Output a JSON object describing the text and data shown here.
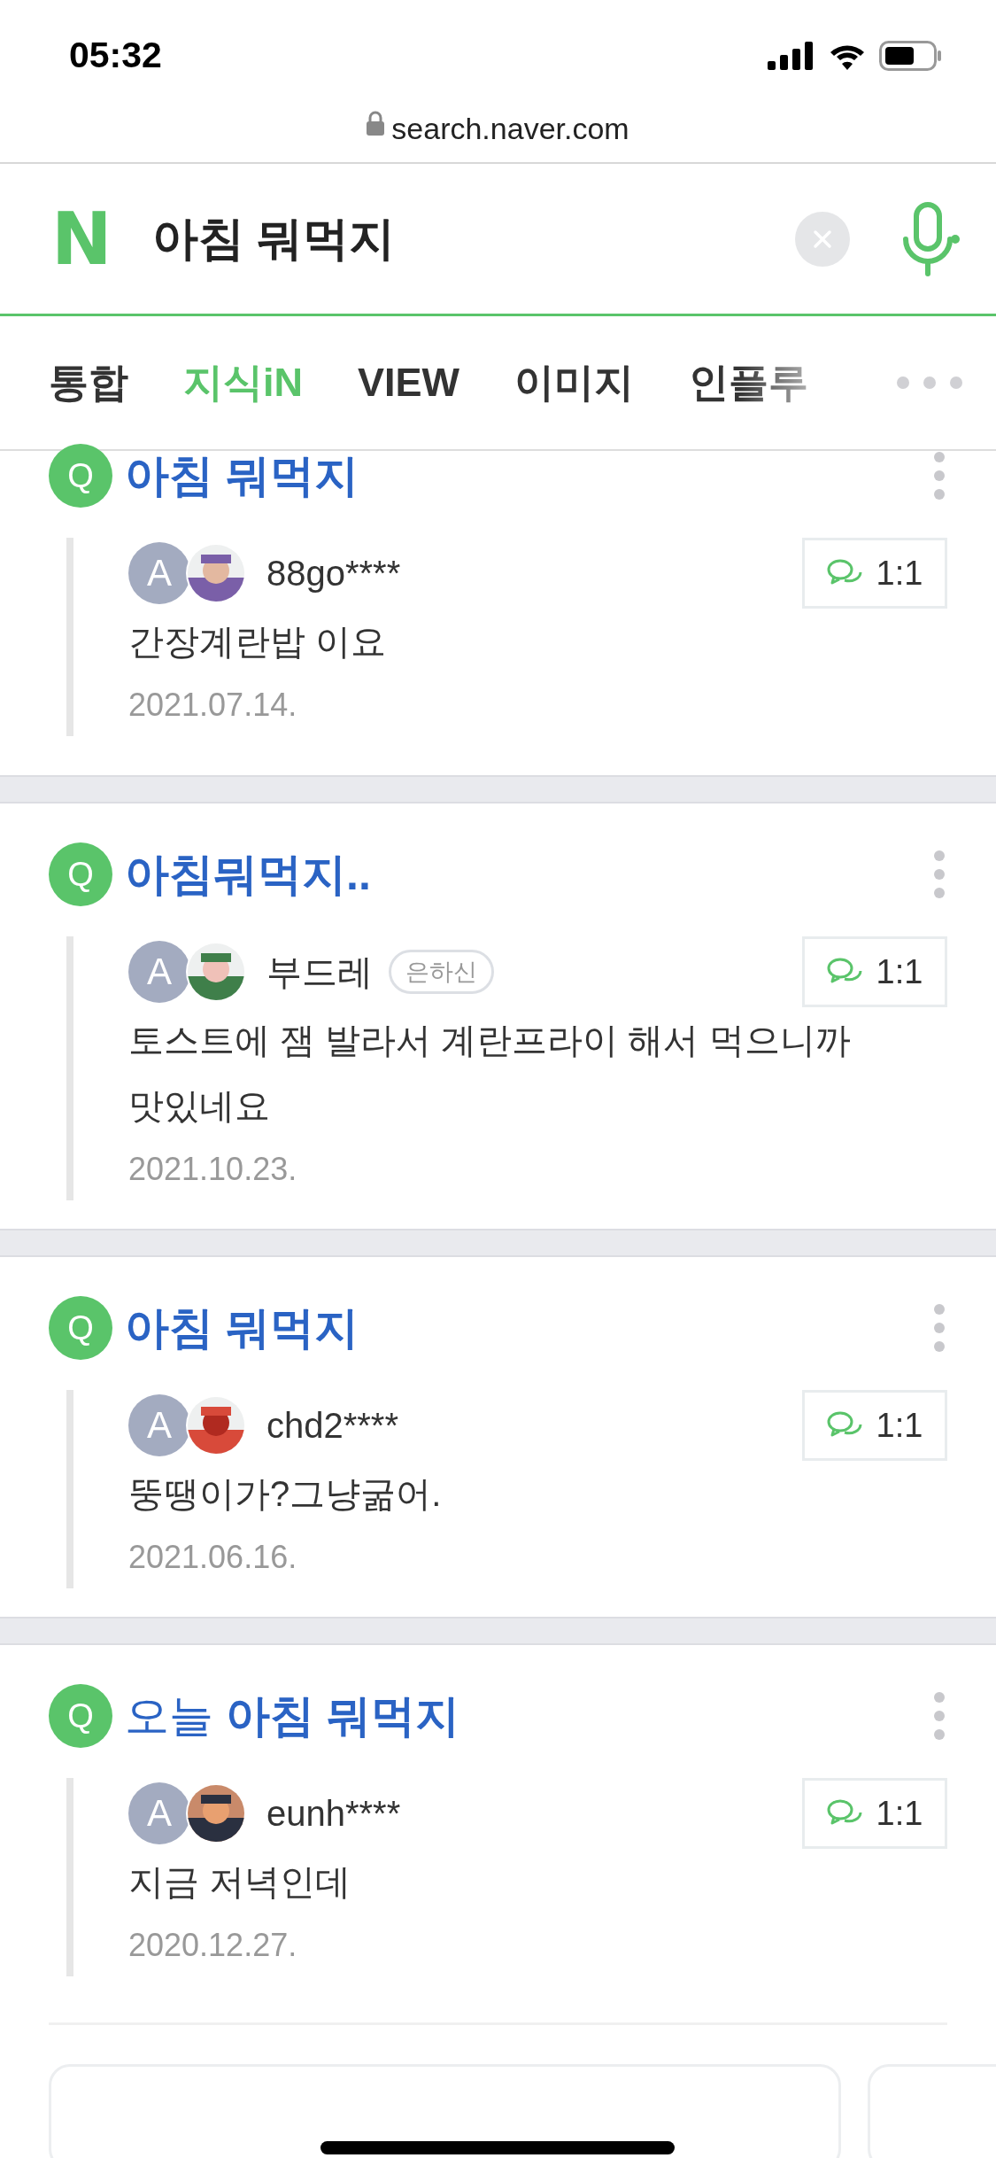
{
  "status_bar": {
    "time": "05:32"
  },
  "address_bar": {
    "url": "search.naver.com"
  },
  "search": {
    "logo": "N",
    "query": "아침 뭐먹지"
  },
  "tabs": [
    {
      "label": "통합",
      "selected": false
    },
    {
      "label": "지식iN",
      "selected": true
    },
    {
      "label": "VIEW",
      "selected": false
    },
    {
      "label": "이미지",
      "selected": false
    },
    {
      "label": "인플루",
      "selected": false
    }
  ],
  "results": [
    {
      "icon": "Q",
      "title": "아침 뭐먹지",
      "title_bold": true,
      "avatar_letter": "A",
      "user": "88go****",
      "answer": "간장계란밥 이요",
      "date": "2021.07.14.",
      "chat": "1:1"
    },
    {
      "icon": "Q",
      "title": "아침뭐먹지..",
      "title_bold": true,
      "avatar_letter": "A",
      "user": "부드레",
      "badge": "은하신",
      "answer": "토스트에 잼 발라서 계란프라이 해서 먹으니까 맛있네요",
      "date": "2021.10.23.",
      "chat": "1:1"
    },
    {
      "icon": "Q",
      "title": "아침 뭐먹지",
      "title_bold": true,
      "avatar_letter": "A",
      "user": "chd2****",
      "answer": "뚱땡이가?그냥굶어.",
      "date": "2021.06.16.",
      "chat": "1:1"
    },
    {
      "icon": "Q",
      "title": "오늘 **아침 뭐먹지**",
      "title_bold": false,
      "avatar_letter": "A",
      "user": "eunh****",
      "answer": "지금 저녁인데",
      "date": "2020.12.27.",
      "chat": "1:1"
    }
  ]
}
